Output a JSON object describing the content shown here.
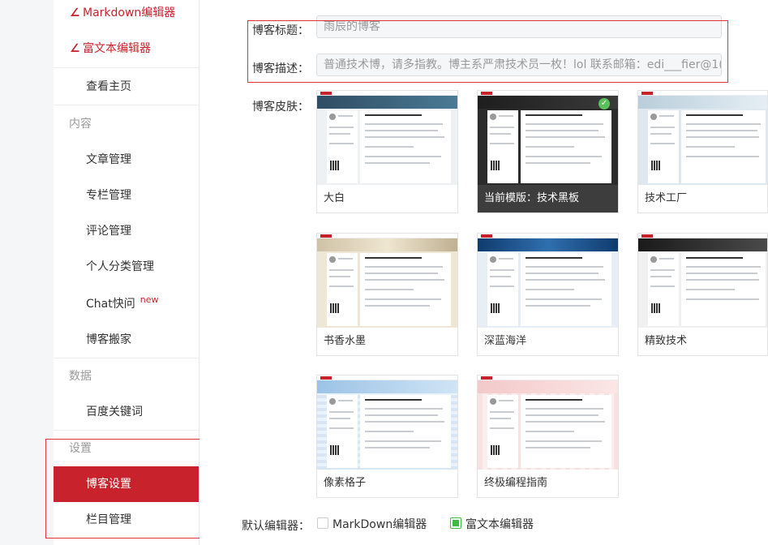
{
  "sidebar": {
    "editors": [
      {
        "label": "Markdown编辑器"
      },
      {
        "label": "富文本编辑器"
      }
    ],
    "home_label": "查看主页",
    "sections": {
      "content": "内容",
      "data": "数据",
      "settings": "设置"
    },
    "content_items": [
      {
        "label": "文章管理"
      },
      {
        "label": "专栏管理"
      },
      {
        "label": "评论管理"
      },
      {
        "label": "个人分类管理"
      },
      {
        "label": "Chat快问",
        "badge": "new"
      },
      {
        "label": "博客搬家"
      }
    ],
    "data_items": [
      {
        "label": "百度关键词"
      }
    ],
    "settings_items": [
      {
        "label": "博客设置",
        "active": true
      },
      {
        "label": "栏目管理"
      }
    ]
  },
  "form": {
    "title_label": "博客标题：",
    "title_value": "雨辰的博客",
    "desc_label": "博客描述：",
    "desc_value": "普通技术博，请多指教。博主系严肃技术员一枚！lol 联系邮箱：edi___fier@1(",
    "skin_label": "博客皮肤：",
    "editor_label": "默认编辑器：",
    "editor_options": [
      {
        "label": "MarkDown编辑器",
        "checked": false
      },
      {
        "label": "富文本编辑器",
        "checked": true
      }
    ]
  },
  "skins": [
    {
      "name": "大白",
      "current": false
    },
    {
      "name": "当前模版：技术黑板",
      "current": true
    },
    {
      "name": "技术工厂",
      "current": false
    },
    {
      "name": "书香水墨",
      "current": false
    },
    {
      "name": "深蓝海洋",
      "current": false
    },
    {
      "name": "精致技术",
      "current": false
    },
    {
      "name": "像素格子",
      "current": false
    },
    {
      "name": "终极编程指南",
      "current": false
    }
  ],
  "colors": {
    "accent": "#c8232c",
    "check": "#5ac05a",
    "outline": "#e0333b"
  },
  "icons": {
    "editor": "pen-icon",
    "current": "check-icon"
  }
}
